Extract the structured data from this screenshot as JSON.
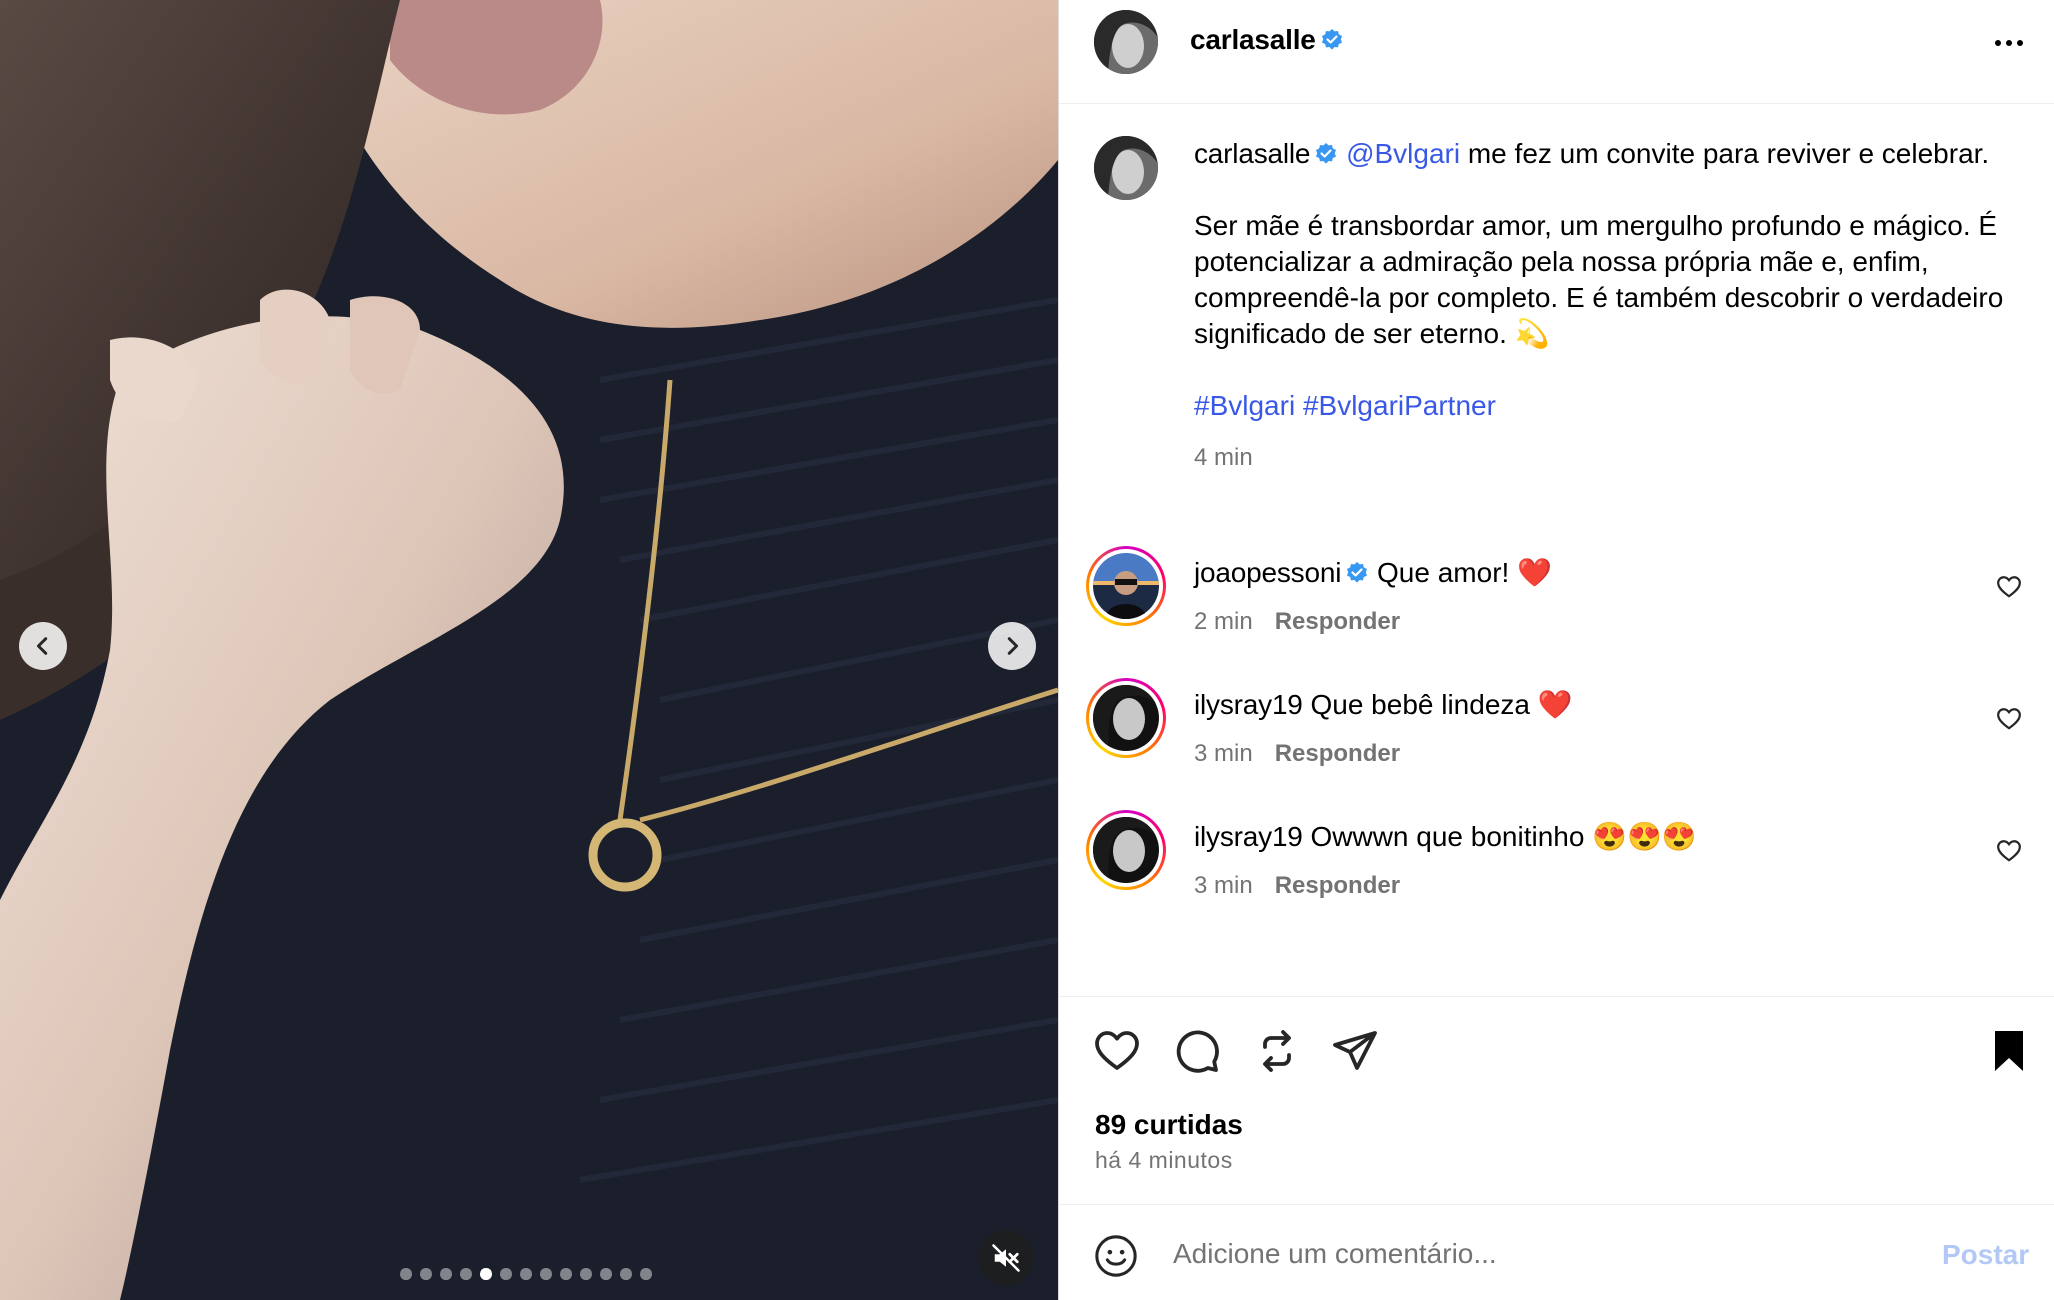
{
  "media": {
    "slide_count": 13,
    "active_slide": 5,
    "prev_icon": "chevron-left-icon",
    "next_icon": "chevron-right-icon",
    "mute_icon": "speaker-muted-icon"
  },
  "post": {
    "author": "carlasalle",
    "verified": true,
    "caption": {
      "mention": "@Bvlgari",
      "line1_rest": " me fez um convite para reviver e celebrar.",
      "paragraph2": "Ser mãe é transbordar amor, um mergulho profundo e mágico. É potencializar a admiração pela nossa própria mãe e, enfim, compreendê-la por completo. E é também descobrir o verdadeiro significado de ser eterno. 💫",
      "hashtag1": "#Bvlgari",
      "hashtag2": "#BvlgariPartner",
      "time": "4 min"
    }
  },
  "comments": [
    {
      "user": "joaopessoni",
      "verified": true,
      "text": "Que amor! ❤️",
      "time": "2 min",
      "reply_label": "Responder"
    },
    {
      "user": "ilysray19",
      "verified": false,
      "text": "Que bebê lindeza ❤️",
      "time": "3 min",
      "reply_label": "Responder"
    },
    {
      "user": "ilysray19",
      "verified": false,
      "text": "Owwwn que bonitinho 😍😍😍",
      "time": "3 min",
      "reply_label": "Responder"
    }
  ],
  "actions": {
    "likes": "89 curtidas",
    "posted": "há 4 minutos"
  },
  "comment_box": {
    "placeholder": "Adicione um comentário...",
    "post_label": "Postar"
  },
  "colors": {
    "link": "#3a58e6",
    "verified": "#3897f0",
    "muted_text": "#737373",
    "post_disabled": "#b3c8f5"
  }
}
